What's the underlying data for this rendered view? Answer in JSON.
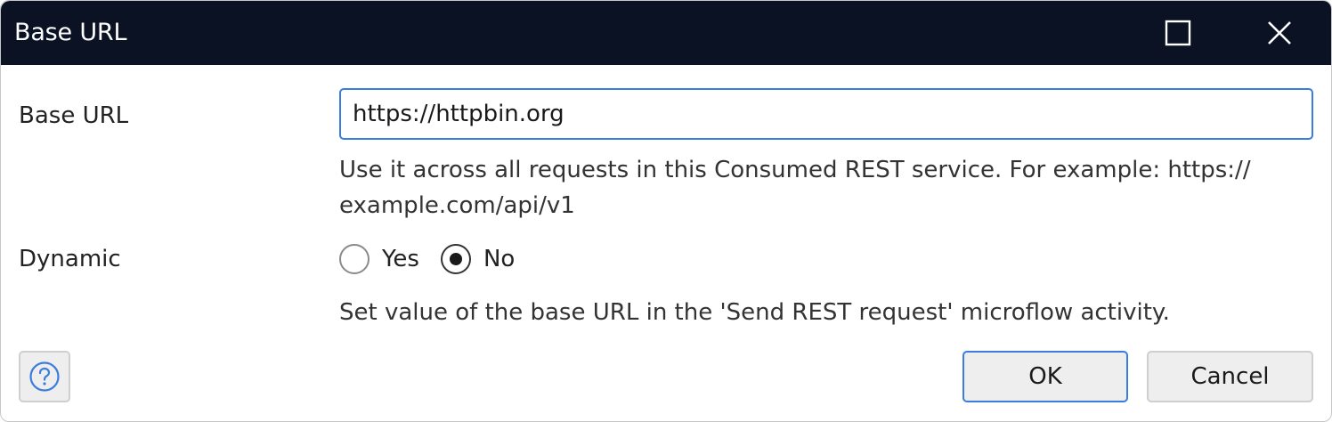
{
  "window": {
    "title": "Base URL",
    "maximize_icon": "maximize-icon",
    "close_icon": "close-icon"
  },
  "form": {
    "base_url_label": "Base URL",
    "base_url_value": "https://httpbin.org",
    "base_url_hint_line1": "Use it across all requests in this Consumed REST service. For example: https://",
    "base_url_hint_line2": "example.com/api/v1",
    "dynamic_label": "Dynamic",
    "dynamic_options": [
      {
        "label": "Yes",
        "selected": false
      },
      {
        "label": "No",
        "selected": true
      }
    ],
    "dynamic_hint": "Set value of the base URL in the 'Send REST request' microflow activity."
  },
  "footer": {
    "help_icon": "help-icon",
    "ok_label": "OK",
    "cancel_label": "Cancel"
  },
  "colors": {
    "titlebar": "#0b1224",
    "focus_accent": "#3b7ddd",
    "help_icon": "#3b7ddd"
  }
}
